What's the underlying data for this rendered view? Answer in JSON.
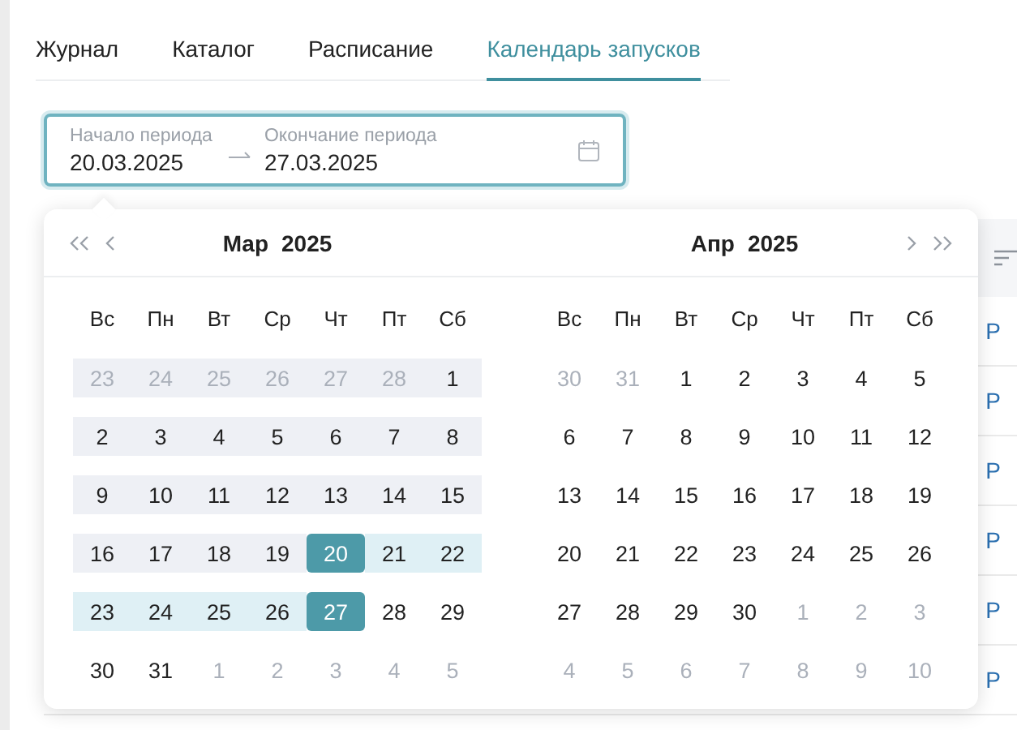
{
  "tabs": [
    {
      "label": "Журнал",
      "selected": false
    },
    {
      "label": "Каталог",
      "selected": false
    },
    {
      "label": "Расписание",
      "selected": false
    },
    {
      "label": "Календарь запусков",
      "selected": true
    }
  ],
  "date_range": {
    "start_label": "Начало периода",
    "start_value": "20.03.2025",
    "end_label": "Окончание периода",
    "end_value": "27.03.2025"
  },
  "table": {
    "rows": [
      {
        "column_1": "P"
      },
      {
        "column_1": "P"
      },
      {
        "column_1": "P"
      },
      {
        "column_1": "P"
      },
      {
        "column_1": "P"
      },
      {
        "column_1": "P"
      }
    ]
  },
  "calendar": {
    "months": [
      {
        "month": "Мар",
        "year": "2025",
        "weekdays": [
          "Вс",
          "Пн",
          "Вт",
          "Ср",
          "Чт",
          "Пт",
          "Сб"
        ],
        "weeks": [
          [
            {
              "label": "23",
              "muted": true,
              "selected": false,
              "in_range": false,
              "shaded": true
            },
            {
              "label": "24",
              "muted": true,
              "selected": false,
              "in_range": false,
              "shaded": true
            },
            {
              "label": "25",
              "muted": true,
              "selected": false,
              "in_range": false,
              "shaded": true
            },
            {
              "label": "26",
              "muted": true,
              "selected": false,
              "in_range": false,
              "shaded": true
            },
            {
              "label": "27",
              "muted": true,
              "selected": false,
              "in_range": false,
              "shaded": true
            },
            {
              "label": "28",
              "muted": true,
              "selected": false,
              "in_range": false,
              "shaded": true
            },
            {
              "label": "1",
              "muted": false,
              "selected": false,
              "in_range": false,
              "shaded": true
            }
          ],
          [
            {
              "label": "2",
              "muted": false,
              "selected": false,
              "in_range": false,
              "shaded": true
            },
            {
              "label": "3",
              "muted": false,
              "selected": false,
              "in_range": false,
              "shaded": true
            },
            {
              "label": "4",
              "muted": false,
              "selected": false,
              "in_range": false,
              "shaded": true
            },
            {
              "label": "5",
              "muted": false,
              "selected": false,
              "in_range": false,
              "shaded": true
            },
            {
              "label": "6",
              "muted": false,
              "selected": false,
              "in_range": false,
              "shaded": true
            },
            {
              "label": "7",
              "muted": false,
              "selected": false,
              "in_range": false,
              "shaded": true
            },
            {
              "label": "8",
              "muted": false,
              "selected": false,
              "in_range": false,
              "shaded": true
            }
          ],
          [
            {
              "label": "9",
              "muted": false,
              "selected": false,
              "in_range": false,
              "shaded": true
            },
            {
              "label": "10",
              "muted": false,
              "selected": false,
              "in_range": false,
              "shaded": true
            },
            {
              "label": "11",
              "muted": false,
              "selected": false,
              "in_range": false,
              "shaded": true
            },
            {
              "label": "12",
              "muted": false,
              "selected": false,
              "in_range": false,
              "shaded": true
            },
            {
              "label": "13",
              "muted": false,
              "selected": false,
              "in_range": false,
              "shaded": true
            },
            {
              "label": "14",
              "muted": false,
              "selected": false,
              "in_range": false,
              "shaded": true
            },
            {
              "label": "15",
              "muted": false,
              "selected": false,
              "in_range": false,
              "shaded": true
            }
          ],
          [
            {
              "label": "16",
              "muted": false,
              "selected": false,
              "in_range": false,
              "shaded": true
            },
            {
              "label": "17",
              "muted": false,
              "selected": false,
              "in_range": false,
              "shaded": true
            },
            {
              "label": "18",
              "muted": false,
              "selected": false,
              "in_range": false,
              "shaded": true
            },
            {
              "label": "19",
              "muted": false,
              "selected": false,
              "in_range": false,
              "shaded": true
            },
            {
              "label": "20",
              "muted": false,
              "selected": true,
              "in_range": false,
              "shaded": false
            },
            {
              "label": "21",
              "muted": false,
              "selected": false,
              "in_range": true,
              "shaded": false
            },
            {
              "label": "22",
              "muted": false,
              "selected": false,
              "in_range": true,
              "shaded": false
            }
          ],
          [
            {
              "label": "23",
              "muted": false,
              "selected": false,
              "in_range": true,
              "shaded": false
            },
            {
              "label": "24",
              "muted": false,
              "selected": false,
              "in_range": true,
              "shaded": false
            },
            {
              "label": "25",
              "muted": false,
              "selected": false,
              "in_range": true,
              "shaded": false
            },
            {
              "label": "26",
              "muted": false,
              "selected": false,
              "in_range": true,
              "shaded": false
            },
            {
              "label": "27",
              "muted": false,
              "selected": true,
              "in_range": false,
              "shaded": false
            },
            {
              "label": "28",
              "muted": false,
              "selected": false,
              "in_range": false,
              "shaded": false
            },
            {
              "label": "29",
              "muted": false,
              "selected": false,
              "in_range": false,
              "shaded": false
            }
          ],
          [
            {
              "label": "30",
              "muted": false,
              "selected": false,
              "in_range": false,
              "shaded": false
            },
            {
              "label": "31",
              "muted": false,
              "selected": false,
              "in_range": false,
              "shaded": false
            },
            {
              "label": "1",
              "muted": true,
              "selected": false,
              "in_range": false,
              "shaded": false
            },
            {
              "label": "2",
              "muted": true,
              "selected": false,
              "in_range": false,
              "shaded": false
            },
            {
              "label": "3",
              "muted": true,
              "selected": false,
              "in_range": false,
              "shaded": false
            },
            {
              "label": "4",
              "muted": true,
              "selected": false,
              "in_range": false,
              "shaded": false
            },
            {
              "label": "5",
              "muted": true,
              "selected": false,
              "in_range": false,
              "shaded": false
            }
          ]
        ]
      },
      {
        "month": "Апр",
        "year": "2025",
        "weekdays": [
          "Вс",
          "Пн",
          "Вт",
          "Ср",
          "Чт",
          "Пт",
          "Сб"
        ],
        "weeks": [
          [
            {
              "label": "30",
              "muted": true,
              "selected": false,
              "in_range": false,
              "shaded": false
            },
            {
              "label": "31",
              "muted": true,
              "selected": false,
              "in_range": false,
              "shaded": false
            },
            {
              "label": "1",
              "muted": false,
              "selected": false,
              "in_range": false,
              "shaded": false
            },
            {
              "label": "2",
              "muted": false,
              "selected": false,
              "in_range": false,
              "shaded": false
            },
            {
              "label": "3",
              "muted": false,
              "selected": false,
              "in_range": false,
              "shaded": false
            },
            {
              "label": "4",
              "muted": false,
              "selected": false,
              "in_range": false,
              "shaded": false
            },
            {
              "label": "5",
              "muted": false,
              "selected": false,
              "in_range": false,
              "shaded": false
            }
          ],
          [
            {
              "label": "6",
              "muted": false,
              "selected": false,
              "in_range": false,
              "shaded": false
            },
            {
              "label": "7",
              "muted": false,
              "selected": false,
              "in_range": false,
              "shaded": false
            },
            {
              "label": "8",
              "muted": false,
              "selected": false,
              "in_range": false,
              "shaded": false
            },
            {
              "label": "9",
              "muted": false,
              "selected": false,
              "in_range": false,
              "shaded": false
            },
            {
              "label": "10",
              "muted": false,
              "selected": false,
              "in_range": false,
              "shaded": false
            },
            {
              "label": "11",
              "muted": false,
              "selected": false,
              "in_range": false,
              "shaded": false
            },
            {
              "label": "12",
              "muted": false,
              "selected": false,
              "in_range": false,
              "shaded": false
            }
          ],
          [
            {
              "label": "13",
              "muted": false,
              "selected": false,
              "in_range": false,
              "shaded": false
            },
            {
              "label": "14",
              "muted": false,
              "selected": false,
              "in_range": false,
              "shaded": false
            },
            {
              "label": "15",
              "muted": false,
              "selected": false,
              "in_range": false,
              "shaded": false
            },
            {
              "label": "16",
              "muted": false,
              "selected": false,
              "in_range": false,
              "shaded": false
            },
            {
              "label": "17",
              "muted": false,
              "selected": false,
              "in_range": false,
              "shaded": false
            },
            {
              "label": "18",
              "muted": false,
              "selected": false,
              "in_range": false,
              "shaded": false
            },
            {
              "label": "19",
              "muted": false,
              "selected": false,
              "in_range": false,
              "shaded": false
            }
          ],
          [
            {
              "label": "20",
              "muted": false,
              "selected": false,
              "in_range": false,
              "shaded": false
            },
            {
              "label": "21",
              "muted": false,
              "selected": false,
              "in_range": false,
              "shaded": false
            },
            {
              "label": "22",
              "muted": false,
              "selected": false,
              "in_range": false,
              "shaded": false
            },
            {
              "label": "23",
              "muted": false,
              "selected": false,
              "in_range": false,
              "shaded": false
            },
            {
              "label": "24",
              "muted": false,
              "selected": false,
              "in_range": false,
              "shaded": false
            },
            {
              "label": "25",
              "muted": false,
              "selected": false,
              "in_range": false,
              "shaded": false
            },
            {
              "label": "26",
              "muted": false,
              "selected": false,
              "in_range": false,
              "shaded": false
            }
          ],
          [
            {
              "label": "27",
              "muted": false,
              "selected": false,
              "in_range": false,
              "shaded": false
            },
            {
              "label": "28",
              "muted": false,
              "selected": false,
              "in_range": false,
              "shaded": false
            },
            {
              "label": "29",
              "muted": false,
              "selected": false,
              "in_range": false,
              "shaded": false
            },
            {
              "label": "30",
              "muted": false,
              "selected": false,
              "in_range": false,
              "shaded": false
            },
            {
              "label": "1",
              "muted": true,
              "selected": false,
              "in_range": false,
              "shaded": false
            },
            {
              "label": "2",
              "muted": true,
              "selected": false,
              "in_range": false,
              "shaded": false
            },
            {
              "label": "3",
              "muted": true,
              "selected": false,
              "in_range": false,
              "shaded": false
            }
          ],
          [
            {
              "label": "4",
              "muted": true,
              "selected": false,
              "in_range": false,
              "shaded": false
            },
            {
              "label": "5",
              "muted": true,
              "selected": false,
              "in_range": false,
              "shaded": false
            },
            {
              "label": "6",
              "muted": true,
              "selected": false,
              "in_range": false,
              "shaded": false
            },
            {
              "label": "7",
              "muted": true,
              "selected": false,
              "in_range": false,
              "shaded": false
            },
            {
              "label": "8",
              "muted": true,
              "selected": false,
              "in_range": false,
              "shaded": false
            },
            {
              "label": "9",
              "muted": true,
              "selected": false,
              "in_range": false,
              "shaded": false
            },
            {
              "label": "10",
              "muted": true,
              "selected": false,
              "in_range": false,
              "shaded": false
            }
          ]
        ]
      }
    ]
  }
}
